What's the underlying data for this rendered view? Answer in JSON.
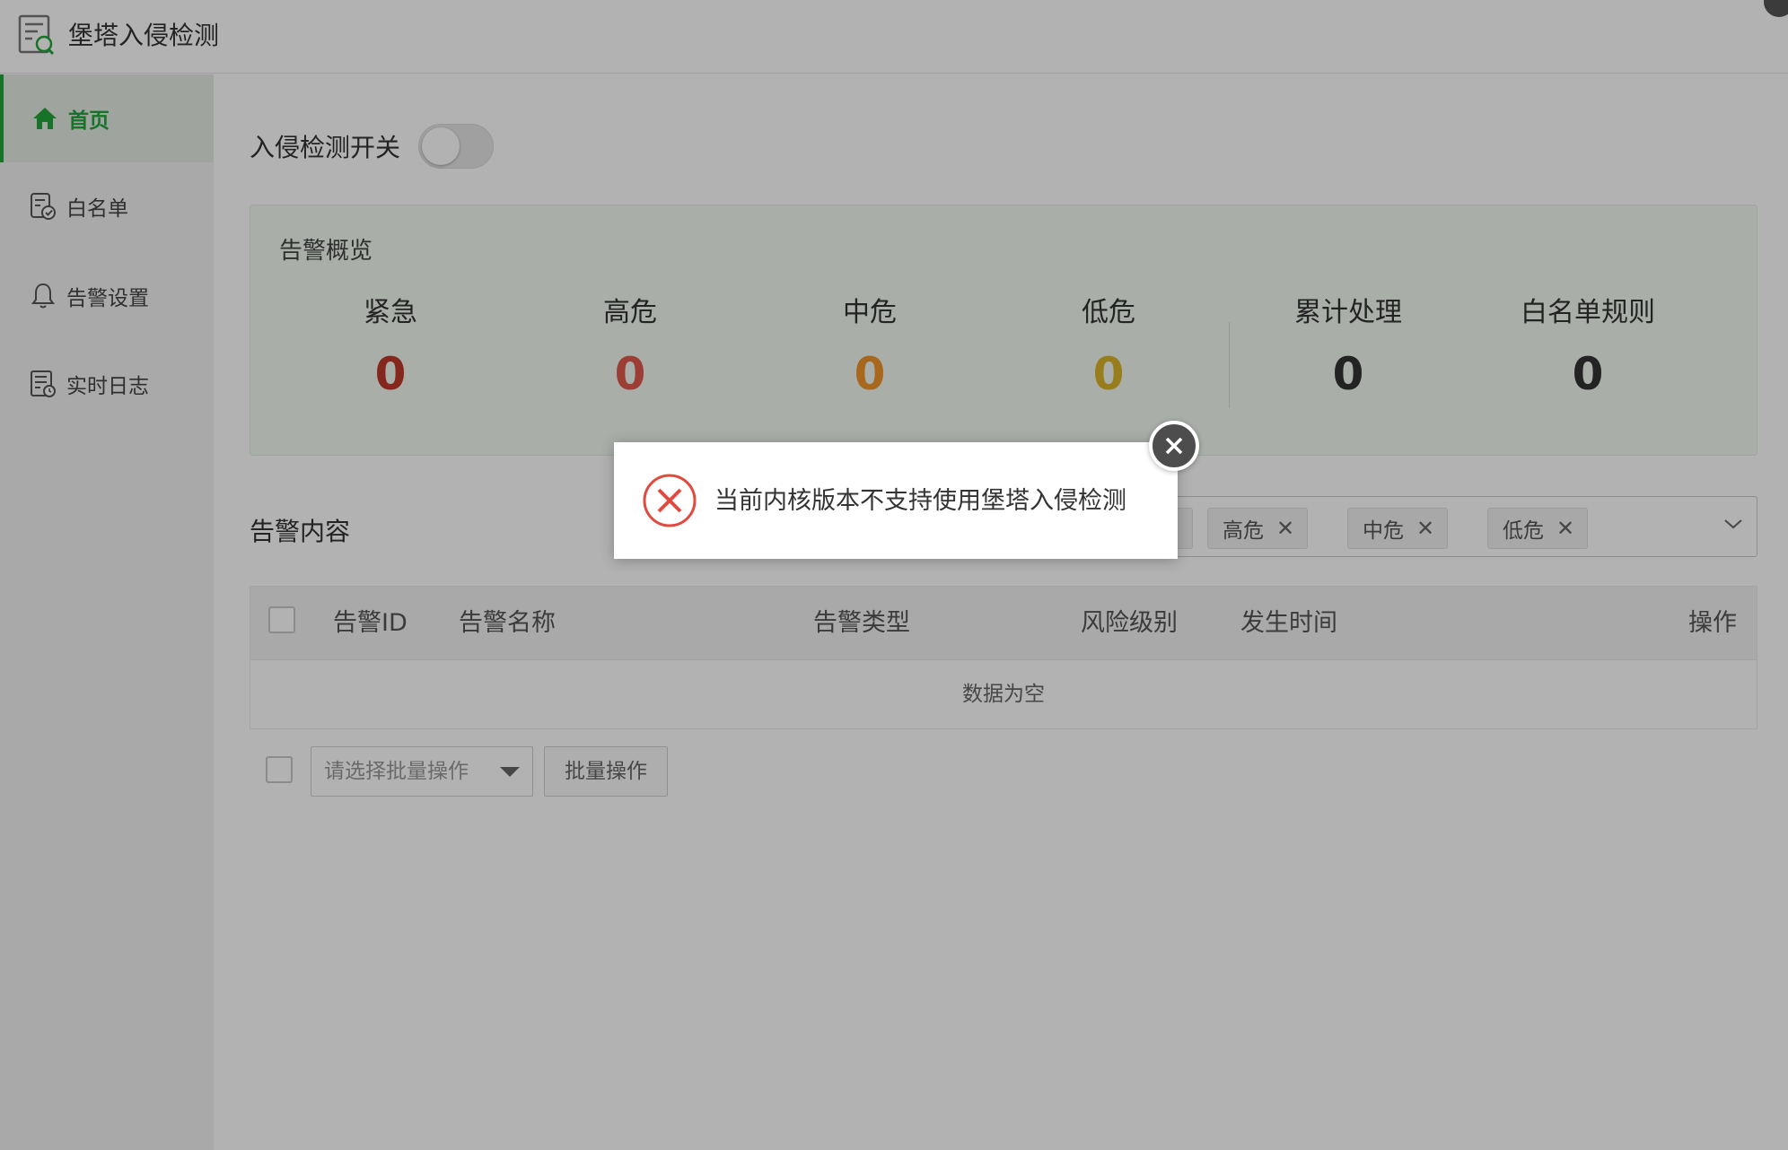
{
  "app": {
    "title": "堡塔入侵检测"
  },
  "sidebar": {
    "items": [
      {
        "label": "首页",
        "icon": "home-icon",
        "active": true
      },
      {
        "label": "白名单",
        "icon": "whitelist-icon",
        "active": false
      },
      {
        "label": "告警设置",
        "icon": "bell-icon",
        "active": false
      },
      {
        "label": "实时日志",
        "icon": "log-icon",
        "active": false
      }
    ]
  },
  "main": {
    "switch_label": "入侵检测开关",
    "switch_on": false,
    "overview": {
      "title": "告警概览",
      "stats": [
        {
          "label": "紧急",
          "value": "0",
          "color": "#c0392b"
        },
        {
          "label": "高危",
          "value": "0",
          "color": "#e05a4e"
        },
        {
          "label": "中危",
          "value": "0",
          "color": "#f0962a"
        },
        {
          "label": "低危",
          "value": "0",
          "color": "#d8b428"
        },
        {
          "label": "累计处理",
          "value": "0",
          "color": "#333333"
        },
        {
          "label": "白名单规则",
          "value": "0",
          "color": "#333333"
        }
      ]
    },
    "alerts": {
      "title": "告警内容",
      "filter_chips": [
        {
          "label": "高危"
        },
        {
          "label": "中危"
        },
        {
          "label": "低危"
        }
      ],
      "table": {
        "columns": [
          "告警ID",
          "告警名称",
          "告警类型",
          "风险级别",
          "发生时间",
          "操作"
        ],
        "empty_text": "数据为空"
      },
      "batch": {
        "select_placeholder": "请选择批量操作",
        "button_label": "批量操作"
      }
    }
  },
  "dialog": {
    "message": "当前内核版本不支持使用堡塔入侵检测",
    "icon": "error-circle-icon"
  },
  "colors": {
    "brand": "#20a53a",
    "error": "#e04a3f"
  }
}
